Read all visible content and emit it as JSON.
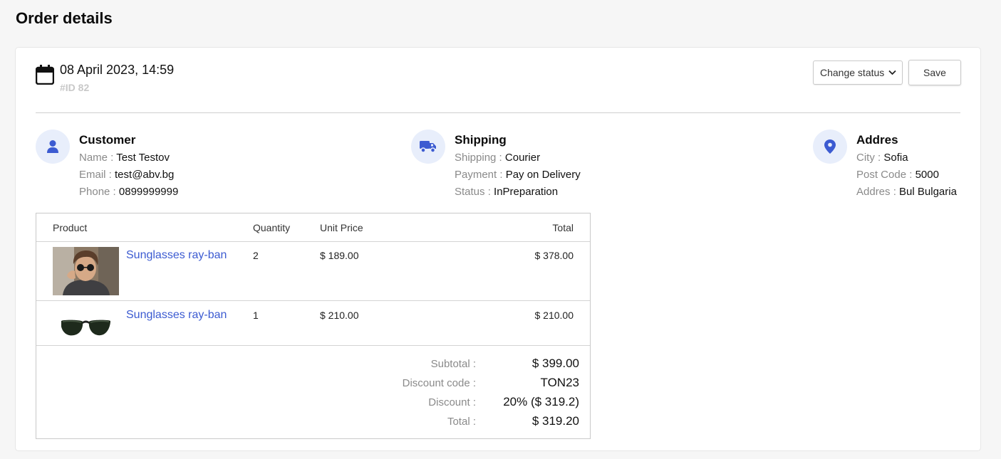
{
  "page": {
    "title": "Order details"
  },
  "order": {
    "date": "08 April 2023, 14:59",
    "id": "#ID 82",
    "status_select": "Change status",
    "save_label": "Save"
  },
  "customer": {
    "title": "Customer",
    "name_label": "Name :",
    "name": "Test Testov",
    "email_label": "Email :",
    "email": "test@abv.bg",
    "phone_label": "Phone :",
    "phone": "0899999999",
    "icon": "user-icon"
  },
  "shipping": {
    "title": "Shipping",
    "shipping_label": "Shipping :",
    "shipping": "Courier",
    "payment_label": "Payment :",
    "payment": "Pay on Delivery",
    "status_label": "Status :",
    "status": "InPreparation",
    "icon": "truck-icon"
  },
  "address": {
    "title": "Addres",
    "city_label": "City :",
    "city": "Sofia",
    "post_label": "Post Code :",
    "post": "5000",
    "addr_label": "Addres :",
    "addr": "Bul Bulgaria",
    "icon": "map-pin-icon"
  },
  "table": {
    "headers": {
      "product": "Product",
      "quantity": "Quantity",
      "unit_price": "Unit Price",
      "total": "Total"
    },
    "rows": [
      {
        "name": "Sunglasses ray-ban",
        "quantity": "2",
        "unit_price": "$ 189.00",
        "total": "$ 378.00",
        "image": "person-wearing-sunglasses-photo"
      },
      {
        "name": "Sunglasses ray-ban",
        "quantity": "1",
        "unit_price": "$ 210.00",
        "total": "$ 210.00",
        "image": "sunglasses-photo"
      }
    ]
  },
  "summary": {
    "subtotal_label": "Subtotal :",
    "subtotal": "$ 399.00",
    "code_label": "Discount code :",
    "code": "TON23",
    "discount_label": "Discount :",
    "discount": "20% ($ 319.2)",
    "total_label": "Total :",
    "total": "$ 319.20"
  },
  "colors": {
    "accent": "#3c5bd1",
    "icon_bg": "#e8eefb",
    "muted": "#8a8a8a"
  }
}
